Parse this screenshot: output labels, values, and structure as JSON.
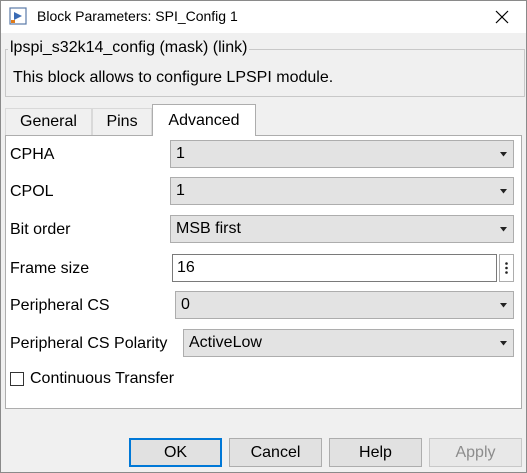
{
  "window": {
    "title": "Block Parameters: SPI_Config 1"
  },
  "group": {
    "legend": "lpspi_s32k14_config (mask) (link)",
    "description": "This block allows to configure LPSPI module."
  },
  "tabs": [
    {
      "label": "General"
    },
    {
      "label": "Pins"
    },
    {
      "label": "Advanced"
    }
  ],
  "params": {
    "cpha": {
      "label": "CPHA",
      "value": "1"
    },
    "cpol": {
      "label": "CPOL",
      "value": "1"
    },
    "bit_order": {
      "label": "Bit order",
      "value": "MSB first"
    },
    "frame_size": {
      "label": "Frame size",
      "value": "16"
    },
    "peripheral_cs": {
      "label": "Peripheral CS",
      "value": "0"
    },
    "peripheral_cs_polarity": {
      "label": "Peripheral CS Polarity",
      "value": "ActiveLow"
    },
    "continuous_transfer": {
      "label": "Continuous Transfer",
      "checked": false
    }
  },
  "buttons": {
    "ok": "OK",
    "cancel": "Cancel",
    "help": "Help",
    "apply": "Apply"
  },
  "colors": {
    "default_button_border": "#0078d7",
    "dropdown_bg": "#e3e3e3"
  }
}
